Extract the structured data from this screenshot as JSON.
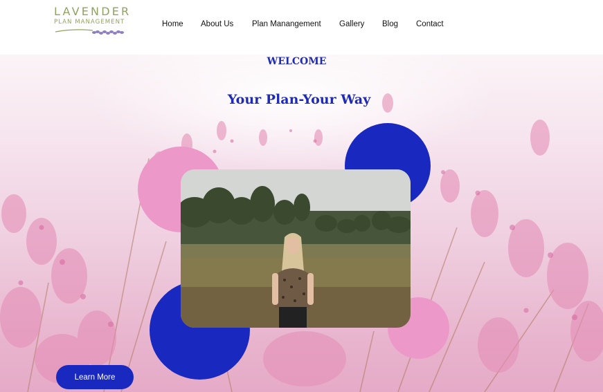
{
  "logo": {
    "title": "LAVENDER",
    "subtitle": "PLAN MANAGEMENT"
  },
  "nav": {
    "items": [
      {
        "label": "Home"
      },
      {
        "label": "About Us"
      },
      {
        "label": "Plan Manangement"
      },
      {
        "label": "Gallery"
      },
      {
        "label": "Blog"
      },
      {
        "label": "Contact"
      }
    ]
  },
  "hero": {
    "eyebrow": "WELCOME",
    "headline": "Your Plan-Your Way",
    "cta_label": "Learn More",
    "image_subject": "woman standing in grassy field",
    "accent_blue": "#1928bf",
    "accent_pink": "#ec98c9",
    "background_subject": "pink wildflower field"
  }
}
